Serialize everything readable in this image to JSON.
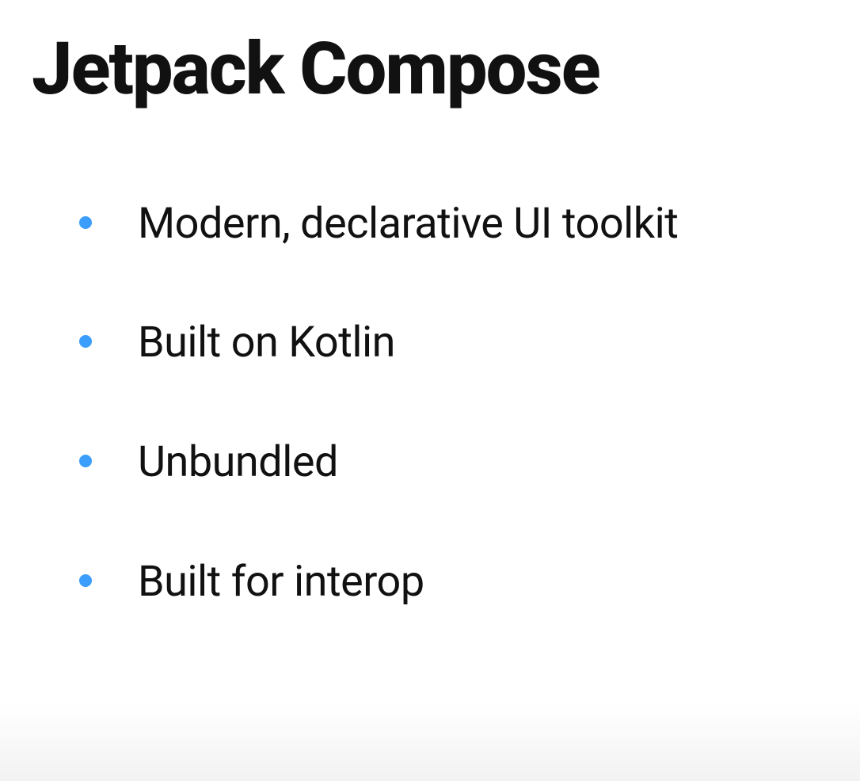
{
  "title": "Jetpack Compose",
  "bullets": [
    "Modern, declarative UI toolkit",
    "Built on Kotlin",
    "Unbundled",
    "Built for interop"
  ],
  "colors": {
    "bullet": "#3b9efc",
    "text": "#111111"
  }
}
